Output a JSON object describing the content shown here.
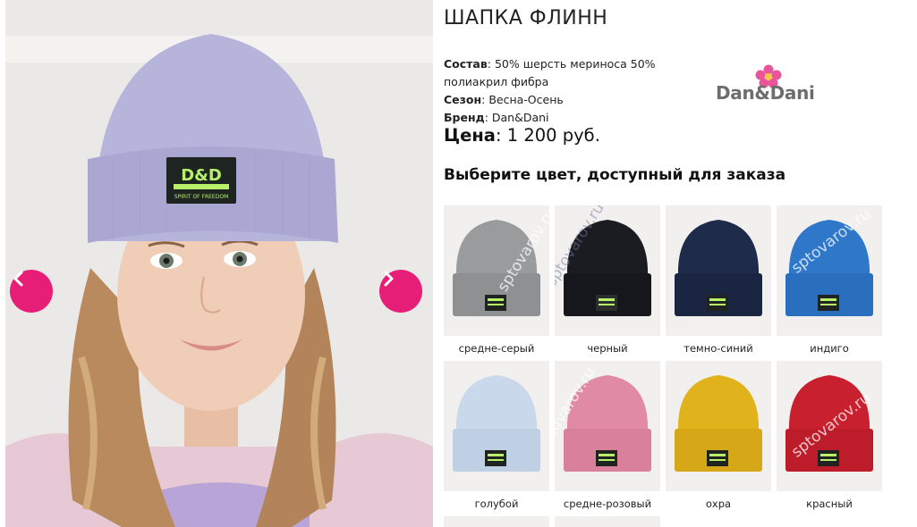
{
  "product": {
    "title": "ШАПКА ФЛИНН",
    "composition_label": "Состав",
    "composition_value": ": 50% шерсть мериноса 50% полиакрил фибра",
    "season_label": "Сезон",
    "season_value": ": Весна-Осень",
    "brand_label": "Бренд",
    "brand_value": ": Dan&Dani",
    "price_label": "Цена",
    "price_value": ": 1 200 руб."
  },
  "brand_logo": {
    "text": "Dan&Dani",
    "flower_color": "#e8559a"
  },
  "gallery": {
    "prev_icon": "chevron-left-icon",
    "next_icon": "chevron-right-icon",
    "nav_color": "#e61e78",
    "patch_text_top": "D&D",
    "patch_text_bottom": "SPIRIT OF FREEDOM"
  },
  "choose_heading": "Выберите цвет, доступный для заказа",
  "watermark": "sptovarov.ru",
  "colors": [
    {
      "name": "средне-серый",
      "hex": "#9a9b9d"
    },
    {
      "name": "черный",
      "hex": "#1b1c22"
    },
    {
      "name": "темно-синий",
      "hex": "#1f2b4a"
    },
    {
      "name": "индиго",
      "hex": "#2f78c9"
    },
    {
      "name": "голубой",
      "hex": "#c9d8ea"
    },
    {
      "name": "средне-розовый",
      "hex": "#e08aa4"
    },
    {
      "name": "охра",
      "hex": "#e0b21c"
    },
    {
      "name": "красный",
      "hex": "#c8202f"
    }
  ]
}
